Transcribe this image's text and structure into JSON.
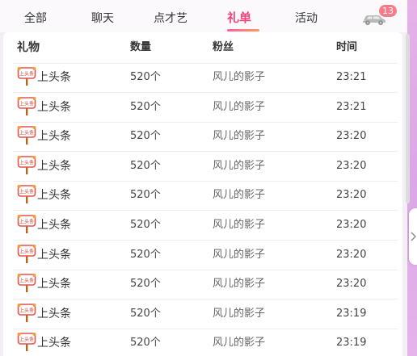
{
  "tabs": [
    {
      "label": "全部",
      "active": false
    },
    {
      "label": "聊天",
      "active": false
    },
    {
      "label": "点才艺",
      "active": false
    },
    {
      "label": "礼单",
      "active": true
    },
    {
      "label": "活动",
      "active": false
    }
  ],
  "car": {
    "icon": "car-icon",
    "badge": "13"
  },
  "colors": {
    "accent": "#f2437b",
    "badge": "#f77c8a",
    "underline_from": "#ff5ea2",
    "underline_to": "#ff9a5c"
  },
  "table": {
    "headers": {
      "gift": "礼物",
      "qty": "数量",
      "fan": "粉丝",
      "time": "时间"
    },
    "gift_icon": "headline-sign-icon",
    "gift_icon_text": "上头条",
    "rows": [
      {
        "gift": "上头条",
        "qty": "520个",
        "fan": "风儿的影子",
        "time": "23:21"
      },
      {
        "gift": "上头条",
        "qty": "520个",
        "fan": "风儿的影子",
        "time": "23:21"
      },
      {
        "gift": "上头条",
        "qty": "520个",
        "fan": "风儿的影子",
        "time": "23:20"
      },
      {
        "gift": "上头条",
        "qty": "520个",
        "fan": "风儿的影子",
        "time": "23:20"
      },
      {
        "gift": "上头条",
        "qty": "520个",
        "fan": "风儿的影子",
        "time": "23:20"
      },
      {
        "gift": "上头条",
        "qty": "520个",
        "fan": "风儿的影子",
        "time": "23:20"
      },
      {
        "gift": "上头条",
        "qty": "520个",
        "fan": "风儿的影子",
        "time": "23:20"
      },
      {
        "gift": "上头条",
        "qty": "520个",
        "fan": "风儿的影子",
        "time": "23:20"
      },
      {
        "gift": "上头条",
        "qty": "520个",
        "fan": "风儿的影子",
        "time": "23:19"
      },
      {
        "gift": "上头条",
        "qty": "520个",
        "fan": "风儿的影子",
        "time": "23:19"
      }
    ]
  }
}
